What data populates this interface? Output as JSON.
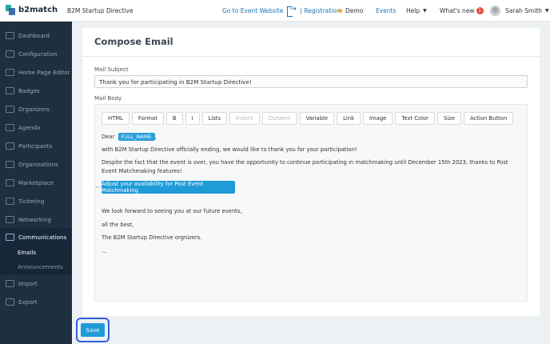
{
  "header": {
    "logo_text": "b2match",
    "app_title": "B2M Startup Directive",
    "go_to_event": "Go to Event Website",
    "registration": "| Registration",
    "demo": "Demo",
    "events": "Events",
    "help": "Help",
    "whats_new": "What's new",
    "whats_new_count": "1",
    "user_name": "Sarah Smith"
  },
  "sidebar": {
    "items": [
      {
        "label": "Dashboard",
        "icon": "dashboard-icon"
      },
      {
        "label": "Configuration",
        "icon": "gear-icon"
      },
      {
        "label": "Home Page Editor",
        "icon": "page-icon"
      },
      {
        "label": "Badges",
        "icon": "badge-icon"
      },
      {
        "label": "Organizers",
        "icon": "people-icon"
      },
      {
        "label": "Agenda",
        "icon": "calendar-icon"
      },
      {
        "label": "Participants",
        "icon": "person-icon"
      },
      {
        "label": "Organizations",
        "icon": "building-icon"
      },
      {
        "label": "Marketplace",
        "icon": "store-icon"
      },
      {
        "label": "Ticketing",
        "icon": "ticket-icon"
      },
      {
        "label": "Networking",
        "icon": "network-icon"
      },
      {
        "label": "Communications",
        "icon": "chat-icon"
      },
      {
        "label": "Import",
        "icon": "import-icon"
      },
      {
        "label": "Export",
        "icon": "export-icon"
      }
    ],
    "sub_items": [
      "Emails",
      "Announcements"
    ]
  },
  "compose": {
    "title": "Compose Email",
    "subject_label": "Mail Subject",
    "subject_value": "Thank you for participating in B2M Startup Directive!",
    "body_label": "Mail Body",
    "toolbar": [
      "HTML",
      "Format",
      "B",
      "I",
      "Lists",
      "Indent",
      "Outdent",
      "Variable",
      "Link",
      "Image",
      "Text Color",
      "Size",
      "Action Button"
    ],
    "body": {
      "greeting": "Dear",
      "variable": "FULL_NAME",
      "greeting_end": ",",
      "line1": "with B2M Startup Directive officially ending, we would like to thank you for your participation!",
      "line2": "Despite the fact that the event is over, you have the opportunity to continue participating in matchmaking until December 15th 2023, thanks to Post Event Matchmaking features!",
      "cta": "Adjust your availability for Post Event Matchmaking",
      "line3": "We look forward to seeing you at our future events,",
      "line4": "all the best,",
      "line5": "The B2M Startup Directive orgnizers.",
      "line6": "..."
    },
    "save_label": "Save"
  }
}
